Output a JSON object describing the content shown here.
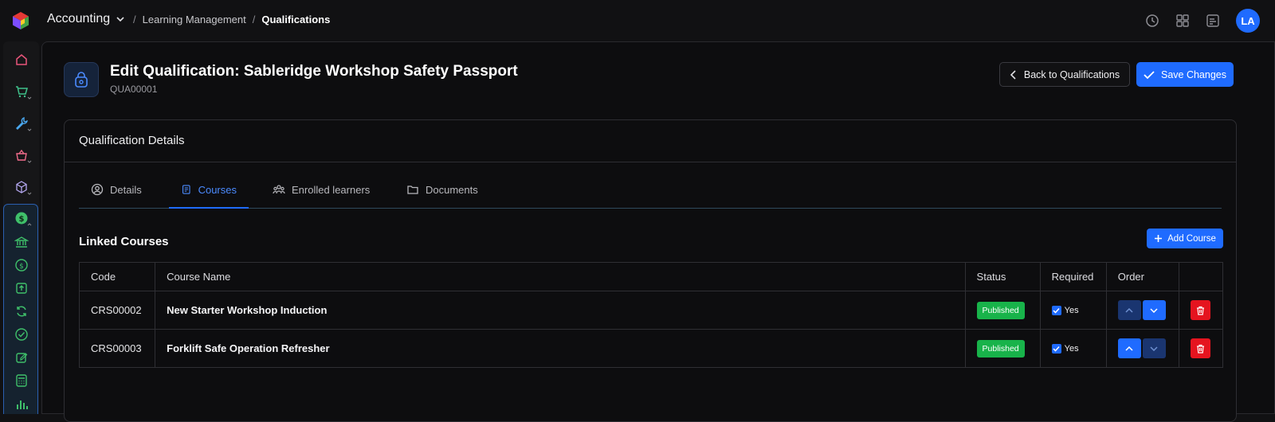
{
  "topbar": {
    "app_name": "Accounting",
    "breadcrumb": [
      "Learning Management",
      "Qualifications"
    ],
    "avatar_initials": "LA",
    "icons": [
      "history-icon",
      "grid-icon",
      "notes-icon"
    ]
  },
  "sidebar": {
    "items": [
      "home-icon",
      "cart-icon",
      "wrench-icon",
      "basket-icon",
      "cube-icon",
      "dollar-icon"
    ],
    "sub_items": [
      "bank-icon",
      "dollar-circle-icon",
      "upload-icon",
      "refresh-icon",
      "check-circle-icon",
      "edit-icon",
      "calculator-icon",
      "bar-chart-icon"
    ]
  },
  "header": {
    "title": "Edit Qualification: Sableridge Workshop Safety Passport",
    "code": "QUA00001",
    "back_label": "Back to Qualifications",
    "save_label": "Save Changes"
  },
  "card": {
    "title": "Qualification Details",
    "tabs": [
      {
        "label": "Details",
        "icon": "user-circle-icon"
      },
      {
        "label": "Courses",
        "icon": "book-icon",
        "active": true
      },
      {
        "label": "Enrolled learners",
        "icon": "users-icon"
      },
      {
        "label": "Documents",
        "icon": "folder-icon"
      }
    ],
    "section_title": "Linked Courses",
    "add_label": "Add Course",
    "table": {
      "headers": [
        "Code",
        "Course Name",
        "Status",
        "Required",
        "Order",
        ""
      ],
      "rows": [
        {
          "code": "CRS00002",
          "name": "New Starter Workshop Induction",
          "status": "Published",
          "required": "Yes"
        },
        {
          "code": "CRS00003",
          "name": "Forklift Safe Operation Refresher",
          "status": "Published",
          "required": "Yes"
        }
      ]
    }
  },
  "colors": {
    "accent": "#1f6bff",
    "success": "#18b34a",
    "danger": "#e5141f"
  }
}
